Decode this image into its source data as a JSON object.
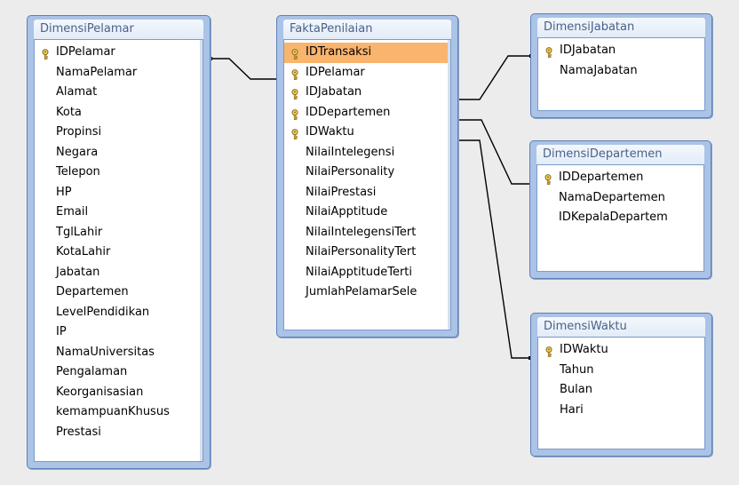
{
  "tables": {
    "pelamar": {
      "title": "DimensiPelamar",
      "fields": [
        "IDPelamar",
        "NamaPelamar",
        "Alamat",
        "Kota",
        "Propinsi",
        "Negara",
        "Telepon",
        "HP",
        "Email",
        "TglLahir",
        "KotaLahir",
        "Jabatan",
        "Departemen",
        "LevelPendidikan",
        "IP",
        "NamaUniversitas",
        "Pengalaman",
        "Keorganisasian",
        "kemampuanKhusus",
        "Prestasi"
      ],
      "keys": [
        0
      ]
    },
    "fakta": {
      "title": "FaktaPenilaian",
      "fields": [
        "IDTransaksi",
        "IDPelamar",
        "IDJabatan",
        "IDDepartemen",
        "IDWaktu",
        "NilaiIntelegensi",
        "NilaiPersonality",
        "NilaiPrestasi",
        "NilaiApptitude",
        "NilaiIntelegensiTert",
        "NilaiPersonalityTert",
        "NilaiApptitudeTerti",
        "JumlahPelamarSele"
      ],
      "keys": [
        0,
        1,
        2,
        3,
        4
      ],
      "selected": 0
    },
    "jabatan": {
      "title": "DimensiJabatan",
      "fields": [
        "IDJabatan",
        "NamaJabatan"
      ],
      "keys": [
        0
      ]
    },
    "departemen": {
      "title": "DimensiDepartemen",
      "fields": [
        "IDDepartemen",
        "NamaDepartemen",
        "IDKepalaDepartem"
      ],
      "keys": [
        0
      ]
    },
    "waktu": {
      "title": "DimensiWaktu",
      "fields": [
        "IDWaktu",
        "Tahun",
        "Bulan",
        "Hari"
      ],
      "keys": [
        0
      ]
    }
  },
  "colors": {
    "window_frame": "#aac3e6",
    "title_text": "#4a6188",
    "selected_row": "#f9b46e",
    "key_icon": "#c9a233"
  },
  "relationships": [
    {
      "from": "DimensiPelamar.IDPelamar",
      "to": "FaktaPenilaian.IDPelamar"
    },
    {
      "from": "FaktaPenilaian.IDJabatan",
      "to": "DimensiJabatan.IDJabatan"
    },
    {
      "from": "FaktaPenilaian.IDDepartemen",
      "to": "DimensiDepartemen.IDDepartemen"
    },
    {
      "from": "FaktaPenilaian.IDWaktu",
      "to": "DimensiWaktu.IDWaktu"
    }
  ]
}
